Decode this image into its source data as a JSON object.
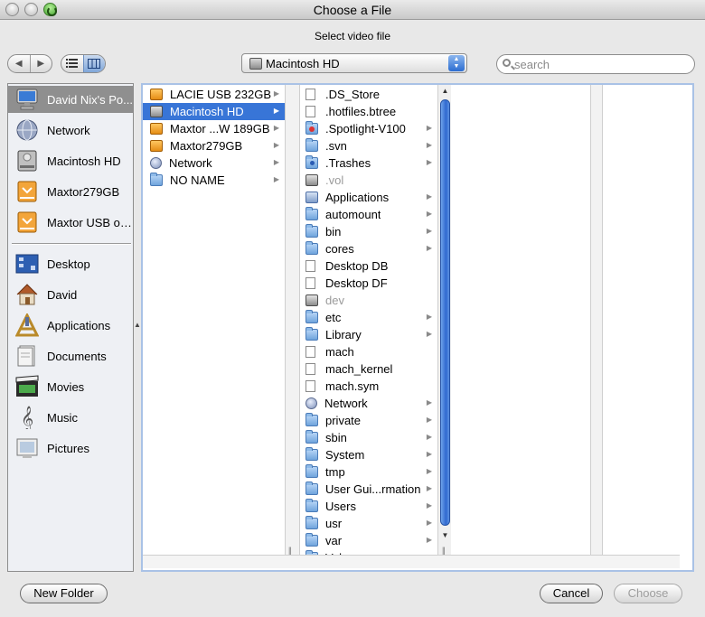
{
  "window": {
    "title": "Choose a File",
    "subtitle": "Select video file"
  },
  "toolbar": {
    "back_glyph": "◀",
    "forward_glyph": "▶",
    "location": "Macintosh HD",
    "search_placeholder": "search"
  },
  "sidebar": {
    "devices": [
      {
        "label": "David Nix's Po...",
        "icon": "computer-icon",
        "selected": true
      },
      {
        "label": "Network",
        "icon": "network-globe-icon"
      },
      {
        "label": "Macintosh HD",
        "icon": "hard-drive-icon"
      },
      {
        "label": "Maxtor279GB",
        "icon": "external-drive-icon"
      },
      {
        "label": "Maxtor USB or...",
        "icon": "external-drive-icon"
      }
    ],
    "places": [
      {
        "label": "Desktop",
        "icon": "desktop-icon"
      },
      {
        "label": "David",
        "icon": "home-icon"
      },
      {
        "label": "Applications",
        "icon": "applications-icon"
      },
      {
        "label": "Documents",
        "icon": "documents-icon"
      },
      {
        "label": "Movies",
        "icon": "movies-icon"
      },
      {
        "label": "Music",
        "icon": "music-icon"
      },
      {
        "label": "Pictures",
        "icon": "pictures-icon"
      }
    ]
  },
  "column1": [
    {
      "label": "LACIE USB 232GB",
      "icon": "ic-drive-orange",
      "arrow": true
    },
    {
      "label": "Macintosh HD",
      "icon": "ic-drive-gray",
      "arrow": true,
      "selected": true
    },
    {
      "label": "Maxtor ...W 189GB",
      "icon": "ic-drive-orange",
      "arrow": true
    },
    {
      "label": "Maxtor279GB",
      "icon": "ic-drive-orange",
      "arrow": true
    },
    {
      "label": "Network",
      "icon": "ic-globe",
      "arrow": true
    },
    {
      "label": "NO NAME",
      "icon": "ic-folder",
      "arrow": true
    }
  ],
  "column2": [
    {
      "label": ".DS_Store",
      "icon": "ic-doc"
    },
    {
      "label": ".hotfiles.btree",
      "icon": "ic-doc"
    },
    {
      "label": ".Spotlight-V100",
      "icon": "ic-folder ic-redbadge",
      "arrow": true
    },
    {
      "label": ".svn",
      "icon": "ic-folder",
      "arrow": true
    },
    {
      "label": ".Trashes",
      "icon": "ic-folder ic-bluebadge",
      "arrow": true
    },
    {
      "label": ".vol",
      "icon": "ic-drive-gray",
      "dim": true
    },
    {
      "label": "Applications",
      "icon": "ic-apps",
      "arrow": true
    },
    {
      "label": "automount",
      "icon": "ic-folder",
      "arrow": true
    },
    {
      "label": "bin",
      "icon": "ic-folder",
      "arrow": true
    },
    {
      "label": "cores",
      "icon": "ic-folder",
      "arrow": true
    },
    {
      "label": "Desktop DB",
      "icon": "ic-doc"
    },
    {
      "label": "Desktop DF",
      "icon": "ic-doc"
    },
    {
      "label": "dev",
      "icon": "ic-drive-gray",
      "dim": true
    },
    {
      "label": "etc",
      "icon": "ic-folder",
      "arrow": true
    },
    {
      "label": "Library",
      "icon": "ic-folder",
      "arrow": true
    },
    {
      "label": "mach",
      "icon": "ic-doc"
    },
    {
      "label": "mach_kernel",
      "icon": "ic-doc"
    },
    {
      "label": "mach.sym",
      "icon": "ic-doc"
    },
    {
      "label": "Network",
      "icon": "ic-globe",
      "arrow": true
    },
    {
      "label": "private",
      "icon": "ic-folder",
      "arrow": true
    },
    {
      "label": "sbin",
      "icon": "ic-folder",
      "arrow": true
    },
    {
      "label": "System",
      "icon": "ic-folder",
      "arrow": true
    },
    {
      "label": "tmp",
      "icon": "ic-folder",
      "arrow": true
    },
    {
      "label": "User Gui...rmation",
      "icon": "ic-folder",
      "arrow": true
    },
    {
      "label": "Users",
      "icon": "ic-folder",
      "arrow": true
    },
    {
      "label": "usr",
      "icon": "ic-folder",
      "arrow": true
    },
    {
      "label": "var",
      "icon": "ic-folder",
      "arrow": true
    },
    {
      "label": "Volumes",
      "icon": "ic-folder",
      "arrow": true
    }
  ],
  "buttons": {
    "new_folder": "New Folder",
    "cancel": "Cancel",
    "choose": "Choose"
  }
}
